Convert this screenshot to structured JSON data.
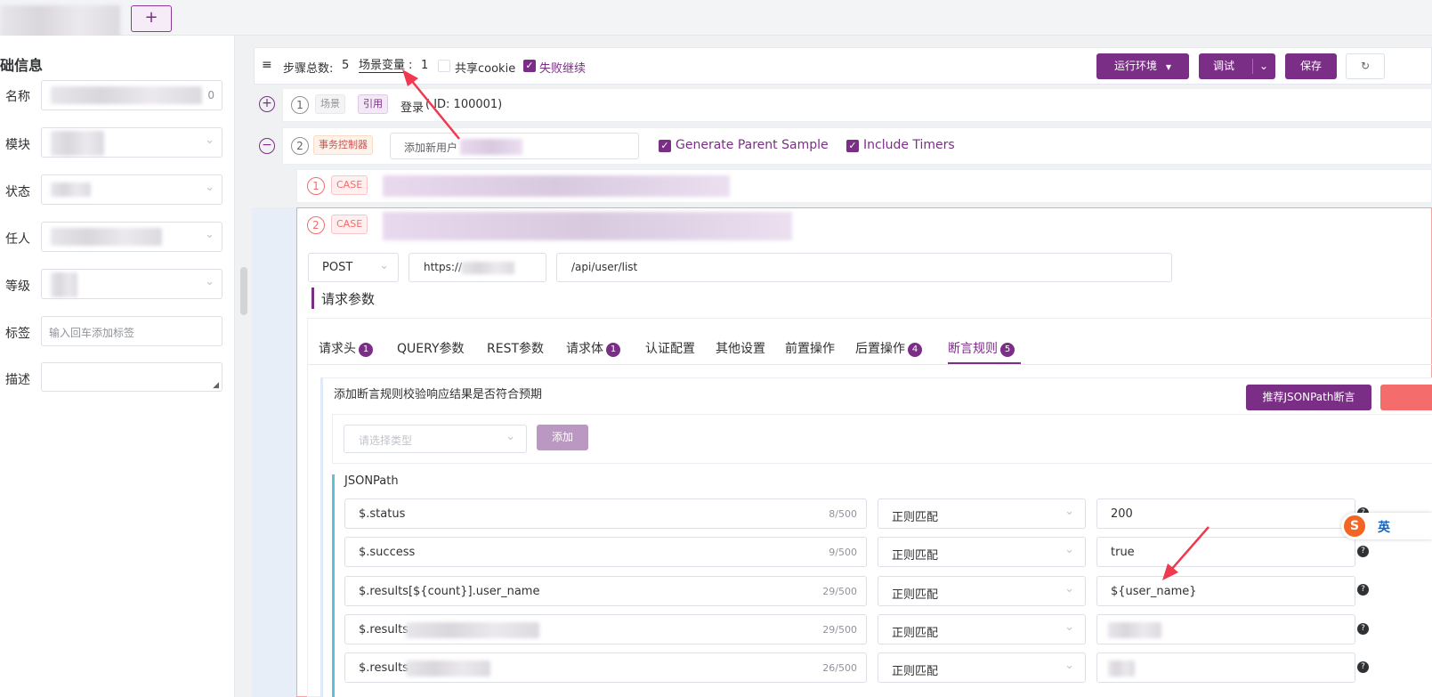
{
  "topbar": {
    "add_tab_label": "+"
  },
  "left_panel": {
    "section_title": "础信息",
    "fields": [
      {
        "label": "名称",
        "suffix": "0"
      },
      {
        "label": "模块"
      },
      {
        "label": "状态"
      },
      {
        "label": "任人"
      },
      {
        "label": "等级"
      },
      {
        "label": "标签",
        "placeholder": "输入回车添加标签"
      },
      {
        "label": "描述"
      }
    ]
  },
  "toolbar": {
    "step_total_label": "步骤总数:",
    "step_total_value": "5",
    "scene_var_label": "场景变量",
    "scene_var_sep": ":",
    "scene_var_value": "1",
    "share_cookie": "共享cookie",
    "fail_continue": "失败继续",
    "env_button": "运行环境",
    "debug_button": "调试",
    "save_button": "保存",
    "refresh_icon": "refresh-icon"
  },
  "steps": [
    {
      "index": "1",
      "tag1": "场景",
      "tag2": "引用",
      "name": "登录",
      "id_text": "( ID: 100001)"
    },
    {
      "index": "2",
      "tag1": "事务控制器",
      "name_value": "添加新用户",
      "opt1": "Generate Parent Sample",
      "opt2": "Include Timers"
    }
  ],
  "cases": [
    {
      "index": "1",
      "tag": "CASE"
    },
    {
      "index": "2",
      "tag": "CASE"
    }
  ],
  "request": {
    "method": "POST",
    "host": "https://",
    "path": "/api/user/list",
    "section_title": "请求参数"
  },
  "tabs": [
    {
      "label": "请求头",
      "badge": "1"
    },
    {
      "label": "QUERY参数"
    },
    {
      "label": "REST参数"
    },
    {
      "label": "请求体",
      "badge": "1"
    },
    {
      "label": "认证配置"
    },
    {
      "label": "其他设置"
    },
    {
      "label": "前置操作"
    },
    {
      "label": "后置操作",
      "badge": "4"
    },
    {
      "label": "断言规则",
      "badge": "5",
      "active": true
    }
  ],
  "assertions": {
    "title": "添加断言规则校验响应结果是否符合预期",
    "recommend_button": "推荐JSONPath断言",
    "type_placeholder": "请选择类型",
    "add_button": "添加",
    "group_title": "JSONPath",
    "rows": [
      {
        "path": "$.status",
        "count": "8/500",
        "match": "正则匹配",
        "value": "200"
      },
      {
        "path": "$.success",
        "count": "9/500",
        "match": "正则匹配",
        "value": "true"
      },
      {
        "path": "$.results[${count}].user_name",
        "count": "29/500",
        "match": "正则匹配",
        "value": "${user_name}"
      },
      {
        "path": "$.results",
        "count": "29/500",
        "match": "正则匹配",
        "value": ""
      },
      {
        "path": "$.results",
        "count": "26/500",
        "match": "正则匹配",
        "value": ""
      }
    ]
  },
  "ime": {
    "label": "英"
  },
  "colors": {
    "primary": "#7a2e86",
    "danger": "#f56c6c",
    "arrow": "#f0384f",
    "accent_bar": "#62bfd8"
  }
}
